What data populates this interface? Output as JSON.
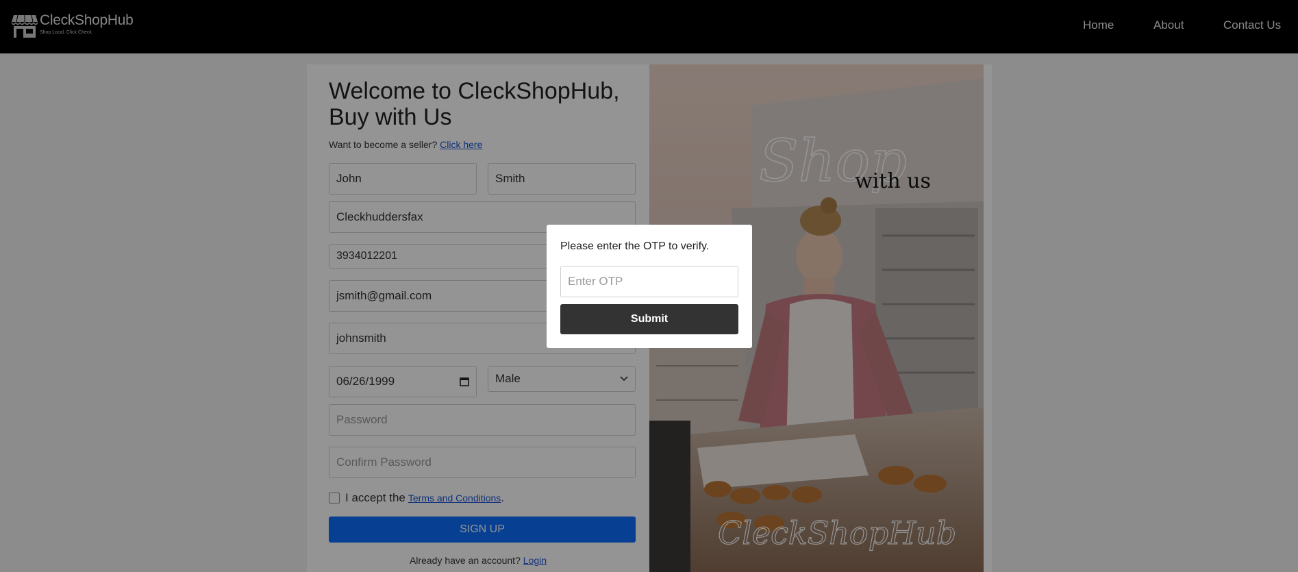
{
  "header": {
    "logo_name": "CleckShopHub",
    "logo_tagline": "Shop Local. Click Check",
    "nav": [
      "Home",
      "About",
      "Contact Us"
    ]
  },
  "form": {
    "title_line1": "Welcome to CleckShopHub,",
    "title_line2": "Buy with Us",
    "seller_prompt": "Want to become a seller?",
    "seller_link": "Click here",
    "first_name": "John",
    "last_name": "Smith",
    "city": "Cleckhuddersfax",
    "phone": "3934012201",
    "email": "jsmith@gmail.com",
    "username": "johnsmith",
    "dob": "06/26/1999",
    "gender": "Male",
    "password_placeholder": "Password",
    "confirm_placeholder": "Confirm Password",
    "terms_prefix": "I accept the",
    "terms_link": "Terms and Conditions",
    "terms_suffix": ".",
    "signup_label": "SIGN UP",
    "login_prompt": "Already have an account?",
    "login_link": "Login"
  },
  "image": {
    "script_top": "Shop",
    "script_sub": "with us",
    "script_bottom": "CleckShopHub"
  },
  "modal": {
    "message": "Please enter the OTP to verify.",
    "otp_placeholder": "Enter OTP",
    "submit_label": "Submit"
  }
}
